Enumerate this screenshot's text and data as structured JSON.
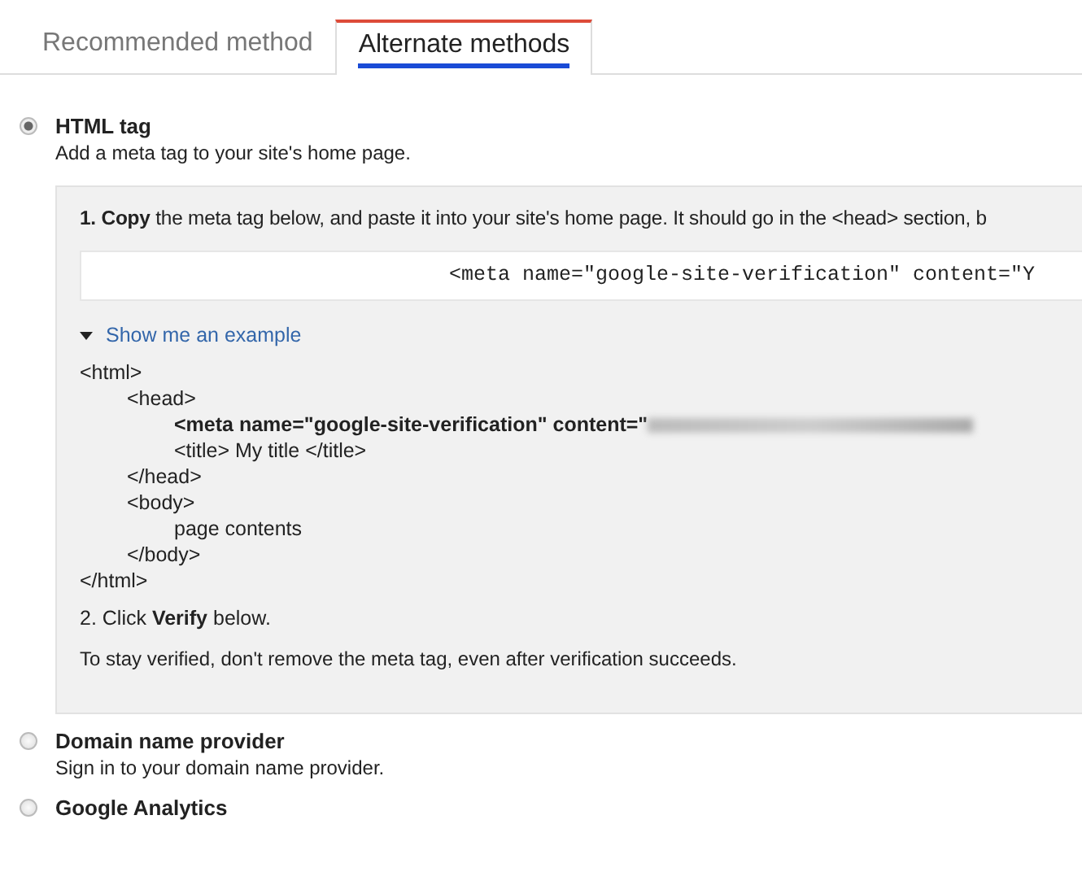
{
  "tabs": [
    {
      "label": "Recommended method",
      "selected": false
    },
    {
      "label": "Alternate methods",
      "selected": true
    }
  ],
  "methods": [
    {
      "title": "HTML tag",
      "description": "Add a meta tag to your site's home page.",
      "selected": true,
      "details": {
        "step_1": "**1. Copy** the meta tag below, and paste it into your site's home page. It should go in the <head> section, b",
        "meta_field": {
          "value": "<meta name=\"google-site-verification\" content=\"Y"
        },
        "example_toggle": {
          "label": "Show me an example",
          "expanded": true
        },
        "example_code": {
          "text": "<html>",
          "children": [
            {
              "text": "<head>",
              "children": [
                {
                  "text": "<meta name=\"google-site-verification\" content=\"",
                  "bold": true,
                  "redacted": true
                },
                {
                  "text": "<title> My title </title>"
                }
              ]
            },
            {
              "text": "</head>"
            },
            {
              "text": "<body>",
              "children": [
                {
                  "text": "page contents"
                }
              ]
            },
            {
              "text": "</body>"
            }
          ]
        },
        "example_code_end": "</html>",
        "step_2": "2. Click **Verify** below.",
        "note": "To stay verified, don't remove the meta tag, even after verification succeeds."
      }
    },
    {
      "title": "Domain name provider",
      "description": "Sign in to your domain name provider.",
      "selected": false
    },
    {
      "title": "Google Analytics",
      "selected": false
    }
  ]
}
